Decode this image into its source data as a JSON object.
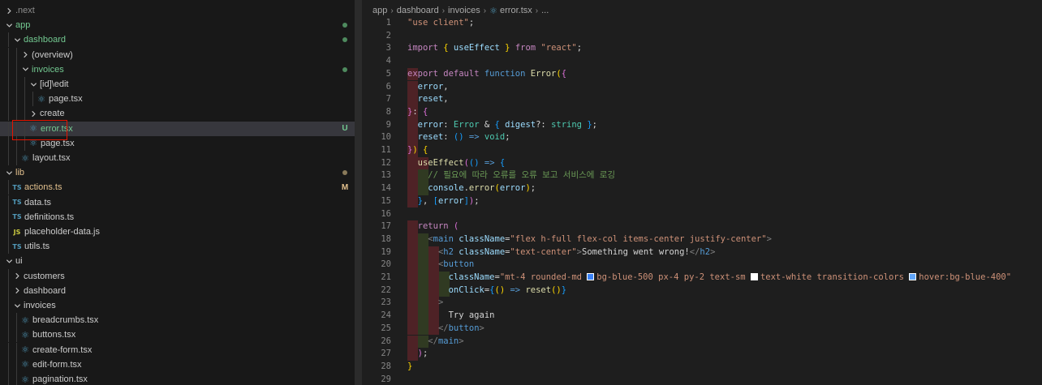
{
  "explorer": {
    "rows": [
      {
        "label": ".next",
        "color": "dim",
        "indent": 0,
        "chevron": "right"
      },
      {
        "label": "app",
        "color": "green",
        "indent": 0,
        "chevron": "down",
        "status": "dot-green"
      },
      {
        "label": "dashboard",
        "color": "green",
        "indent": 1,
        "chevron": "down",
        "status": "dot-green"
      },
      {
        "label": "(overview)",
        "color": "default",
        "indent": 2,
        "chevron": "right"
      },
      {
        "label": "invoices",
        "color": "green",
        "indent": 2,
        "chevron": "down",
        "status": "dot-green"
      },
      {
        "label": "[id]\\edit",
        "color": "default",
        "indent": 3,
        "chevron": "down"
      },
      {
        "label": "page.tsx",
        "color": "default",
        "indent": 4,
        "file": "react"
      },
      {
        "label": "create",
        "color": "default",
        "indent": 3,
        "chevron": "right"
      },
      {
        "label": "error.tsx",
        "color": "green",
        "indent": 3,
        "file": "react",
        "status": "U",
        "selected": true
      },
      {
        "label": "page.tsx",
        "color": "default",
        "indent": 3,
        "file": "react"
      },
      {
        "label": "layout.tsx",
        "color": "default",
        "indent": 2,
        "file": "react"
      },
      {
        "label": "lib",
        "color": "yellow",
        "indent": 0,
        "chevron": "down",
        "status": "dot-yellow"
      },
      {
        "label": "actions.ts",
        "color": "yellow",
        "indent": 1,
        "file": "ts",
        "status": "M"
      },
      {
        "label": "data.ts",
        "color": "default",
        "indent": 1,
        "file": "ts"
      },
      {
        "label": "definitions.ts",
        "color": "default",
        "indent": 1,
        "file": "ts"
      },
      {
        "label": "placeholder-data.js",
        "color": "default",
        "indent": 1,
        "file": "js"
      },
      {
        "label": "utils.ts",
        "color": "default",
        "indent": 1,
        "file": "ts"
      },
      {
        "label": "ui",
        "color": "default",
        "indent": 0,
        "chevron": "down"
      },
      {
        "label": "customers",
        "color": "default",
        "indent": 1,
        "chevron": "right"
      },
      {
        "label": "dashboard",
        "color": "default",
        "indent": 1,
        "chevron": "right"
      },
      {
        "label": "invoices",
        "color": "default",
        "indent": 1,
        "chevron": "down"
      },
      {
        "label": "breadcrumbs.tsx",
        "color": "default",
        "indent": 2,
        "file": "react"
      },
      {
        "label": "buttons.tsx",
        "color": "default",
        "indent": 2,
        "file": "react"
      },
      {
        "label": "create-form.tsx",
        "color": "default",
        "indent": 2,
        "file": "react"
      },
      {
        "label": "edit-form.tsx",
        "color": "default",
        "indent": 2,
        "file": "react"
      },
      {
        "label": "pagination.tsx",
        "color": "default",
        "indent": 2,
        "file": "react"
      }
    ],
    "icons": {
      "react": "⚛",
      "ts": "TS",
      "js": "JS"
    },
    "colors": {
      "green": "#73c991",
      "yellow": "#e2c08d",
      "selection_box": "#e51400"
    }
  },
  "breadcrumb": [
    "app",
    "dashboard",
    "invoices",
    "error.tsx",
    "..."
  ],
  "code": {
    "lines": [
      {
        "n": "1",
        "tokens": [
          [
            "st",
            "\"use client\""
          ],
          [
            "txt",
            ";"
          ]
        ]
      },
      {
        "n": "2",
        "tokens": []
      },
      {
        "n": "3",
        "tokens": [
          [
            "kw",
            "import"
          ],
          [
            "txt",
            " "
          ],
          [
            "br1",
            "{"
          ],
          [
            "txt",
            " "
          ],
          [
            "var",
            "useEffect"
          ],
          [
            "txt",
            " "
          ],
          [
            "br1",
            "}"
          ],
          [
            "txt",
            " "
          ],
          [
            "kw",
            "from"
          ],
          [
            "txt",
            " "
          ],
          [
            "st",
            "\"react\""
          ],
          [
            "txt",
            ";"
          ]
        ]
      },
      {
        "n": "4",
        "tokens": []
      },
      {
        "n": "5",
        "tokens": [
          [
            "kw",
            "export"
          ],
          [
            "txt",
            " "
          ],
          [
            "kw",
            "default"
          ],
          [
            "txt",
            " "
          ],
          [
            "def",
            "function"
          ],
          [
            "txt",
            " "
          ],
          [
            "fn",
            "Error"
          ],
          [
            "br1",
            "("
          ],
          [
            "br2",
            "{"
          ]
        ],
        "bands": [
          "red"
        ]
      },
      {
        "n": "6",
        "tokens": [
          [
            "txt",
            "  "
          ],
          [
            "var",
            "error"
          ],
          [
            "txt",
            ","
          ]
        ],
        "bands": [
          "red"
        ]
      },
      {
        "n": "7",
        "tokens": [
          [
            "txt",
            "  "
          ],
          [
            "var",
            "reset"
          ],
          [
            "txt",
            ","
          ]
        ],
        "bands": [
          "red"
        ]
      },
      {
        "n": "8",
        "tokens": [
          [
            "br2",
            "}"
          ],
          [
            "txt",
            ": "
          ],
          [
            "br2",
            "{"
          ]
        ],
        "bands": [
          "red"
        ]
      },
      {
        "n": "9",
        "tokens": [
          [
            "txt",
            "  "
          ],
          [
            "var",
            "error"
          ],
          [
            "txt",
            ": "
          ],
          [
            "ty",
            "Error"
          ],
          [
            "txt",
            " & "
          ],
          [
            "br3",
            "{"
          ],
          [
            "txt",
            " "
          ],
          [
            "var",
            "digest"
          ],
          [
            "txt",
            "?: "
          ],
          [
            "ty",
            "string"
          ],
          [
            "txt",
            " "
          ],
          [
            "br3",
            "}"
          ],
          [
            "txt",
            ";"
          ]
        ],
        "bands": [
          "red"
        ]
      },
      {
        "n": "10",
        "tokens": [
          [
            "txt",
            "  "
          ],
          [
            "var",
            "reset"
          ],
          [
            "txt",
            ": "
          ],
          [
            "br3",
            "()"
          ],
          [
            "txt",
            " "
          ],
          [
            "def",
            "=>"
          ],
          [
            "txt",
            " "
          ],
          [
            "ty",
            "void"
          ],
          [
            "txt",
            ";"
          ]
        ],
        "bands": [
          "red"
        ]
      },
      {
        "n": "11",
        "tokens": [
          [
            "br2",
            "}"
          ],
          [
            "br1",
            ")"
          ],
          [
            "txt",
            " "
          ],
          [
            "br1",
            "{"
          ]
        ],
        "bands": [
          "red"
        ]
      },
      {
        "n": "12",
        "tokens": [
          [
            "txt",
            "  "
          ],
          [
            "fn",
            "useEffect"
          ],
          [
            "br2",
            "("
          ],
          [
            "br3",
            "()"
          ],
          [
            "txt",
            " "
          ],
          [
            "def",
            "=>"
          ],
          [
            "txt",
            " "
          ],
          [
            "br3",
            "{"
          ]
        ],
        "bands": [
          "red",
          "red"
        ]
      },
      {
        "n": "13",
        "tokens": [
          [
            "txt",
            "    "
          ],
          [
            "cm",
            "// 필요에 따라 오류를 오류 보고 서비스에 로깅"
          ]
        ],
        "bands": [
          "red",
          "olive"
        ]
      },
      {
        "n": "14",
        "tokens": [
          [
            "txt",
            "    "
          ],
          [
            "var",
            "console"
          ],
          [
            "txt",
            "."
          ],
          [
            "fn",
            "error"
          ],
          [
            "br1",
            "("
          ],
          [
            "var",
            "error"
          ],
          [
            "br1",
            ")"
          ],
          [
            "txt",
            ";"
          ]
        ],
        "bands": [
          "red",
          "olive"
        ]
      },
      {
        "n": "15",
        "tokens": [
          [
            "txt",
            "  "
          ],
          [
            "br3",
            "}"
          ],
          [
            "txt",
            ", "
          ],
          [
            "br3",
            "["
          ],
          [
            "var",
            "error"
          ],
          [
            "br3",
            "]"
          ],
          [
            "br2",
            ")"
          ],
          [
            "txt",
            ";"
          ]
        ],
        "bands": [
          "red"
        ]
      },
      {
        "n": "16",
        "tokens": []
      },
      {
        "n": "17",
        "tokens": [
          [
            "txt",
            "  "
          ],
          [
            "kw",
            "return"
          ],
          [
            "txt",
            " "
          ],
          [
            "br2",
            "("
          ]
        ],
        "bands": [
          "red"
        ]
      },
      {
        "n": "18",
        "tokens": [
          [
            "txt",
            "    "
          ],
          [
            "gray",
            "<"
          ],
          [
            "tag",
            "main"
          ],
          [
            "txt",
            " "
          ],
          [
            "var",
            "className"
          ],
          [
            "txt",
            "="
          ],
          [
            "st",
            "\"flex h-full flex-col items-center justify-center\""
          ],
          [
            "gray",
            ">"
          ]
        ],
        "bands": [
          "red",
          "olive"
        ]
      },
      {
        "n": "19",
        "tokens": [
          [
            "txt",
            "      "
          ],
          [
            "gray",
            "<"
          ],
          [
            "tag",
            "h2"
          ],
          [
            "txt",
            " "
          ],
          [
            "var",
            "className"
          ],
          [
            "txt",
            "="
          ],
          [
            "st",
            "\"text-center\""
          ],
          [
            "gray",
            ">"
          ],
          [
            "txt",
            "Something went wrong!"
          ],
          [
            "gray",
            "</"
          ],
          [
            "tag",
            "h2"
          ],
          [
            "gray",
            ">"
          ]
        ],
        "bands": [
          "red",
          "olive",
          "red"
        ]
      },
      {
        "n": "20",
        "tokens": [
          [
            "txt",
            "      "
          ],
          [
            "gray",
            "<"
          ],
          [
            "tag",
            "button"
          ]
        ],
        "bands": [
          "red",
          "olive",
          "red"
        ]
      },
      {
        "n": "21",
        "tokens": [
          [
            "txt",
            "        "
          ],
          [
            "var",
            "className"
          ],
          [
            "txt",
            "="
          ],
          [
            "st",
            "\"mt-4 rounded-md "
          ],
          [
            "sw",
            "#3b82f6"
          ],
          [
            "st",
            "bg-blue-500 px-4 py-2 text-sm "
          ],
          [
            "sw",
            "#ffffff"
          ],
          [
            "st",
            "text-white transition-colors "
          ],
          [
            "sw",
            "#60a5fa"
          ],
          [
            "st",
            "hover:bg-blue-400\""
          ]
        ],
        "bands": [
          "red",
          "olive",
          "red",
          "olive"
        ]
      },
      {
        "n": "22",
        "tokens": [
          [
            "txt",
            "        "
          ],
          [
            "var",
            "onClick"
          ],
          [
            "txt",
            "="
          ],
          [
            "br3",
            "{"
          ],
          [
            "br1",
            "()"
          ],
          [
            "txt",
            " "
          ],
          [
            "def",
            "=>"
          ],
          [
            "txt",
            " "
          ],
          [
            "fn",
            "reset"
          ],
          [
            "br1",
            "()"
          ],
          [
            "br3",
            "}"
          ]
        ],
        "bands": [
          "red",
          "olive",
          "red",
          "olive"
        ]
      },
      {
        "n": "23",
        "tokens": [
          [
            "txt",
            "      "
          ],
          [
            "gray",
            ">"
          ]
        ],
        "bands": [
          "red",
          "olive",
          "red"
        ]
      },
      {
        "n": "24",
        "tokens": [
          [
            "txt",
            "        Try again"
          ]
        ],
        "bands": [
          "red",
          "olive",
          "red"
        ]
      },
      {
        "n": "25",
        "tokens": [
          [
            "txt",
            "      "
          ],
          [
            "gray",
            "</"
          ],
          [
            "tag",
            "button"
          ],
          [
            "gray",
            ">"
          ]
        ],
        "bands": [
          "red",
          "olive",
          "red"
        ]
      },
      {
        "n": "26",
        "tokens": [
          [
            "txt",
            "    "
          ],
          [
            "gray",
            "</"
          ],
          [
            "tag",
            "main"
          ],
          [
            "gray",
            ">"
          ]
        ],
        "bands": [
          "red",
          "olive"
        ]
      },
      {
        "n": "27",
        "tokens": [
          [
            "txt",
            "  "
          ],
          [
            "br2",
            ")"
          ],
          [
            "txt",
            ";"
          ]
        ],
        "bands": [
          "red"
        ]
      },
      {
        "n": "28",
        "tokens": [
          [
            "br1",
            "}"
          ]
        ]
      },
      {
        "n": "29",
        "tokens": []
      }
    ]
  }
}
